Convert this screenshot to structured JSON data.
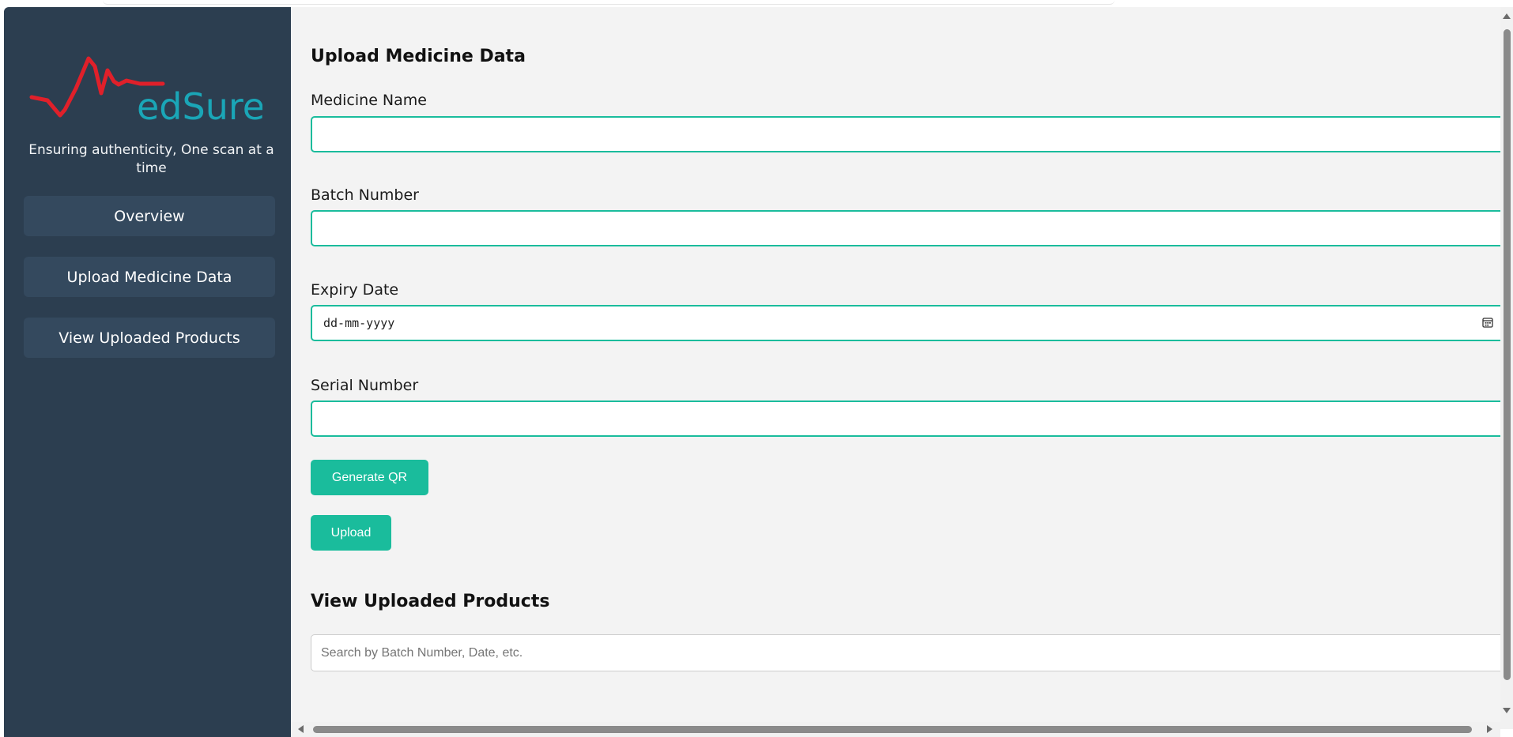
{
  "brand": {
    "logo_text": "edSure",
    "tagline": "Ensuring authenticity, One scan at a time",
    "colors": {
      "pulse": "#e0202a",
      "text": "#1aa6b7"
    }
  },
  "sidebar": {
    "items": [
      {
        "label": "Overview"
      },
      {
        "label": "Upload Medicine Data"
      },
      {
        "label": "View Uploaded Products"
      }
    ]
  },
  "upload": {
    "title": "Upload Medicine Data",
    "fields": [
      {
        "label": "Medicine Name",
        "value": ""
      },
      {
        "label": "Batch Number",
        "value": ""
      },
      {
        "label": "Expiry Date",
        "value": "dd-mm-yyyy",
        "icon": "calendar-icon"
      },
      {
        "label": "Serial Number",
        "value": ""
      }
    ],
    "generate_label": "Generate QR",
    "upload_label": "Upload"
  },
  "products": {
    "title": "View Uploaded Products",
    "search_placeholder": "Search by Batch Number, Date, etc."
  },
  "theme": {
    "sidebar_bg": "#2c3e50",
    "nav_bg": "#34495e",
    "accent": "#1abc9c",
    "main_bg": "#f3f3f3"
  }
}
